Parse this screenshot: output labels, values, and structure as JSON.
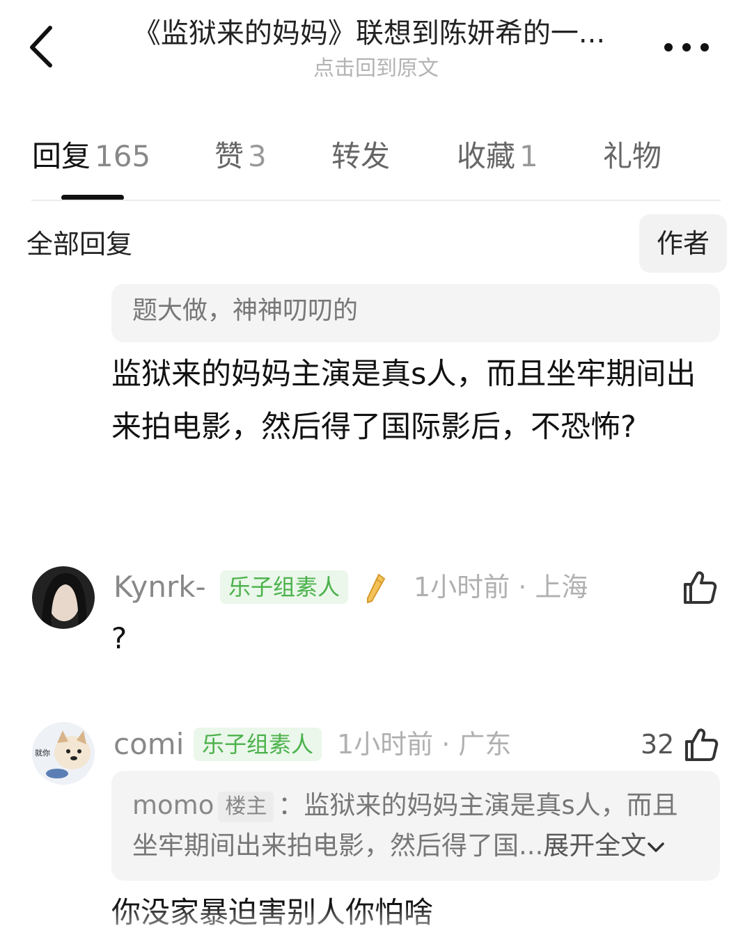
{
  "header": {
    "title": "《监狱来的妈妈》联想到陈妍希的一...",
    "subtitle": "点击回到原文"
  },
  "tabs": [
    {
      "label": "回复",
      "count": "165"
    },
    {
      "label": "赞",
      "count": "3"
    },
    {
      "label": "转发",
      "count": ""
    },
    {
      "label": "收藏",
      "count": "1"
    },
    {
      "label": "礼物",
      "count": ""
    }
  ],
  "filter": {
    "label": "全部回复",
    "author_button": "作者"
  },
  "parent_reply": {
    "quote": "题大做，神神叨叨的",
    "text": "监狱来的妈妈主演是真s人，而且坐牢期间出来拍电影，然后得了国际影后，不恐怖?"
  },
  "comments": [
    {
      "username": "Kynrk-",
      "badge": "乐子组素人",
      "time": "1小时前 · 上海",
      "likes": "",
      "text": "?"
    },
    {
      "username": "comi",
      "badge": "乐子组素人",
      "time": "1小时前 · 广东",
      "likes": "32",
      "quote_user": "momo",
      "quote_tag": "楼主",
      "quote_line1": "：监狱来的妈妈主演是真s人，而且",
      "quote_line2": "坐牢期间出来拍电影，然后得了国...",
      "expand": "展开全文",
      "text": "你没家暴迫害别人你怕啥"
    }
  ],
  "colors": {
    "badge_green": "#4bb14b",
    "badge_bg": "#eaf7ea",
    "quote_bg": "#f4f4f4"
  }
}
